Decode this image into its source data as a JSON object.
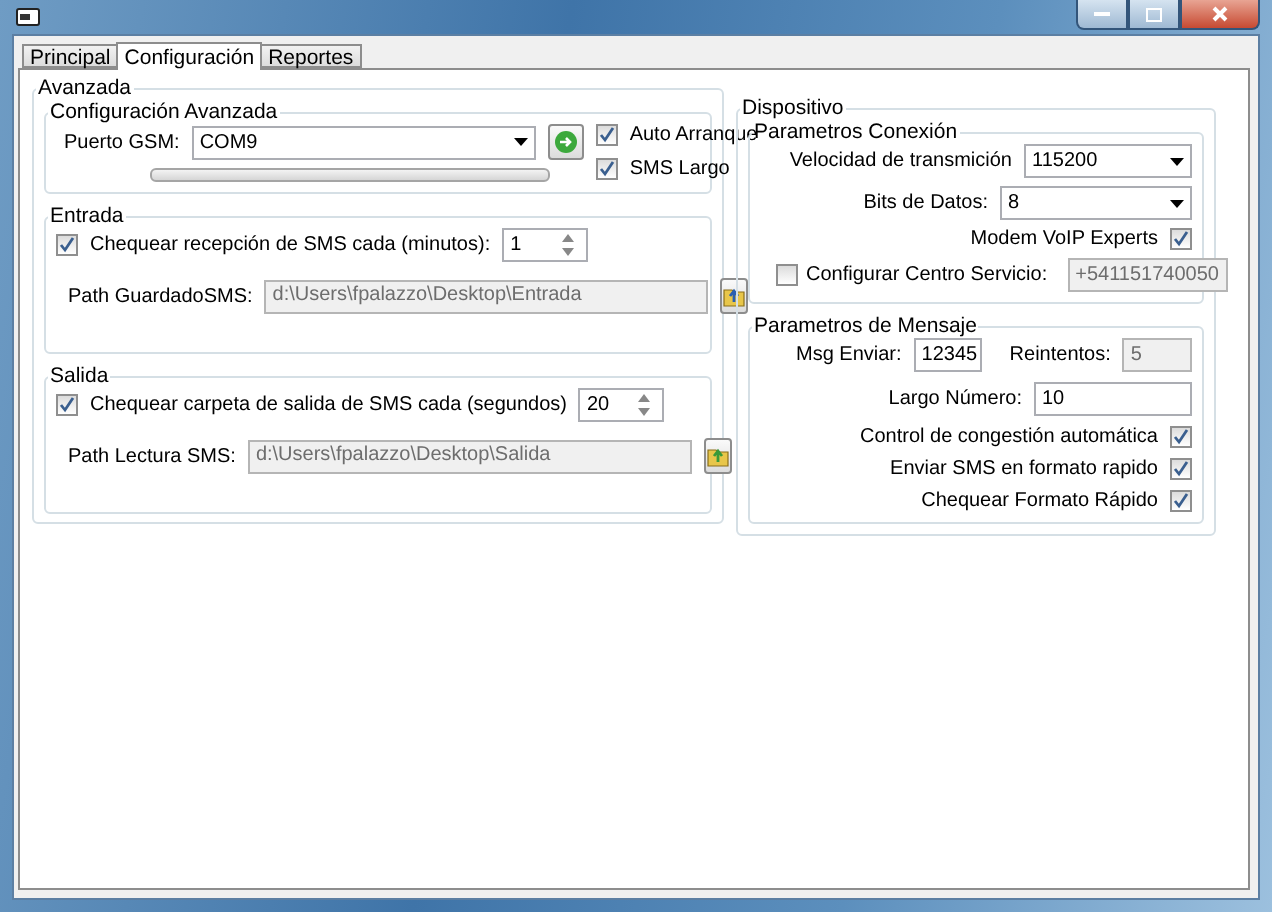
{
  "tabs": [
    {
      "label": "Principal",
      "selected": false
    },
    {
      "label": "Configuración",
      "selected": true
    },
    {
      "label": "Reportes",
      "selected": false
    }
  ],
  "avanzada": {
    "title": "Avanzada",
    "config": {
      "title": "Configuración Avanzada",
      "port_label": "Puerto GSM:",
      "port_value": "COM9",
      "level": 0,
      "options": [
        {
          "label": "Auto Arranque",
          "checked": true
        },
        {
          "label": "SMS Largo",
          "checked": true
        }
      ]
    },
    "entrada": {
      "title": "Entrada",
      "check": {
        "label": "Chequear recepción de SMS cada (minutos):",
        "checked": true
      },
      "interval": "1",
      "path_label": "Path GuardadoSMS:",
      "path": "d:\\Users\\fpalazzo\\Desktop\\Entrada"
    },
    "salida": {
      "title": "Salida",
      "check": {
        "label": "Chequear carpeta de salida de SMS cada (segundos)",
        "checked": true
      },
      "interval": "20",
      "path_label": "Path Lectura SMS:",
      "path": "d:\\Users\\fpalazzo\\Desktop\\Salida"
    }
  },
  "dispositivo": {
    "title": "Dispositivo",
    "conexion": {
      "title": "Parametros Conexión",
      "velocidad_label": "Velocidad de transmición",
      "velocidad": "115200",
      "bits_label": "Bits de Datos:",
      "bits": "8",
      "voip": {
        "label": "Modem VoIP Experts",
        "checked": true
      },
      "centro": {
        "label": "Configurar Centro Servicio:",
        "checked": false,
        "value": "+541151740050",
        "disabled": true
      }
    },
    "mensaje": {
      "title": "Parametros de Mensaje",
      "msg_label": "Msg Enviar:",
      "msg": "12345",
      "reintentos_label": "Reintentos:",
      "reintentos": "5",
      "reintentos_disabled": true,
      "largo_label": "Largo Número:",
      "largo": "10",
      "options": [
        {
          "label": "Control de congestión automática",
          "checked": true
        },
        {
          "label": "Enviar SMS en formato rapido",
          "checked": true
        },
        {
          "label": "Chequear Formato Rápido",
          "checked": true
        }
      ]
    }
  }
}
